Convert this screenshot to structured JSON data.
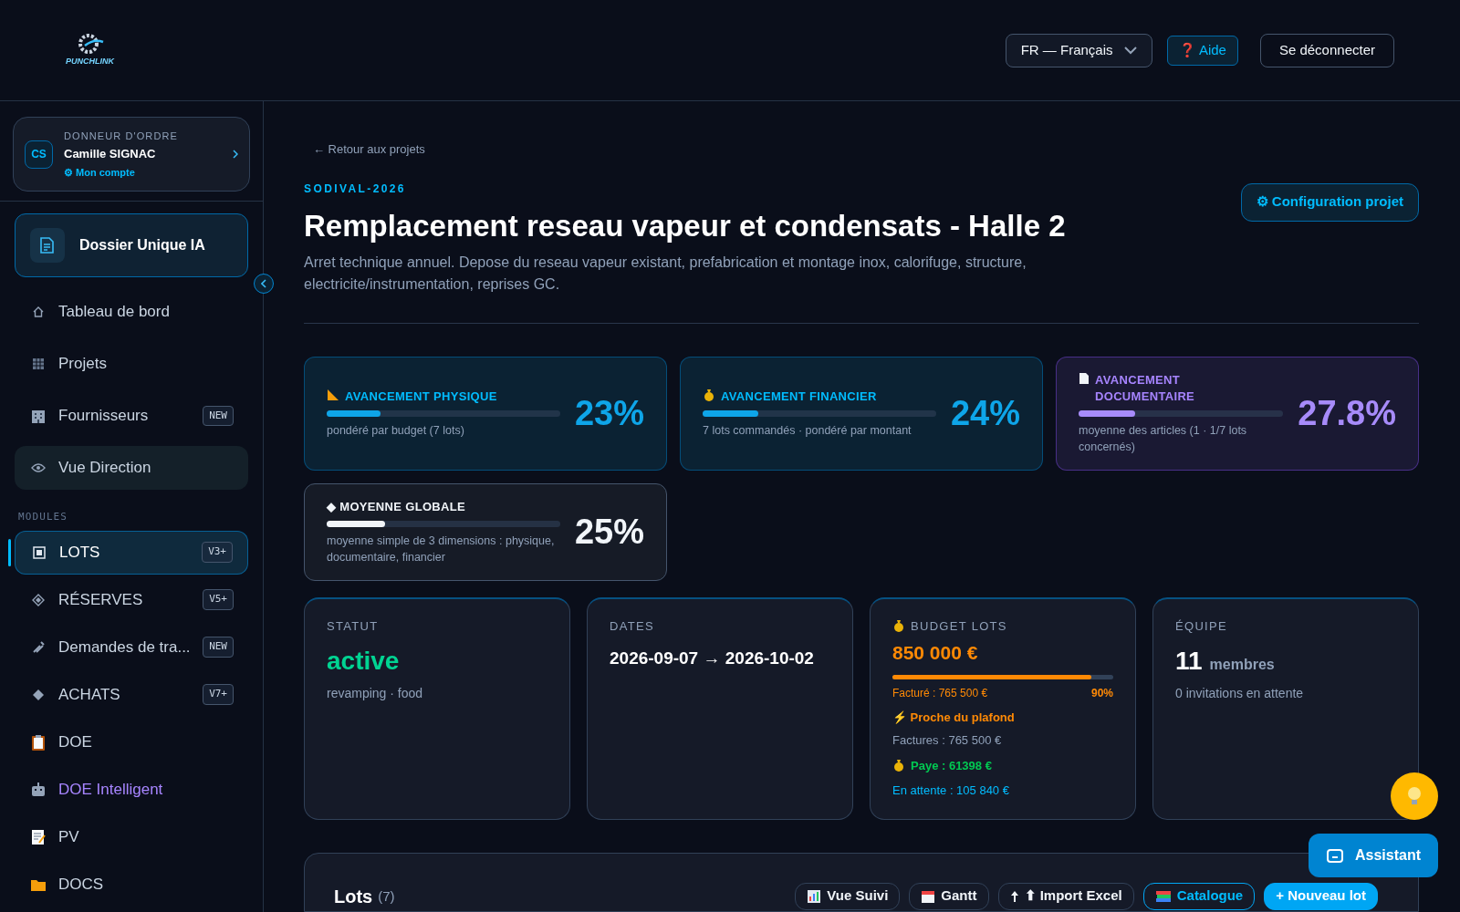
{
  "header": {
    "logo_text": "PUNCHLINK",
    "language": "FR — Français",
    "help": "❓ Aide",
    "logout": "Se déconnecter"
  },
  "sidebar": {
    "user": {
      "initials": "CS",
      "role": "DONNEUR D'ORDRE",
      "name": "Camille SIGNAC",
      "account": "⚙ Mon compte"
    },
    "featured": "Dossier Unique IA",
    "items": [
      {
        "label": "Tableau de bord",
        "kind": "nav",
        "selected": false
      },
      {
        "label": "Projets",
        "kind": "nav",
        "selected": false
      },
      {
        "label": "Fournisseurs",
        "kind": "nav",
        "badge": "NEW",
        "selected": false
      },
      {
        "label": "Vue Direction",
        "kind": "card",
        "selected": false
      }
    ],
    "section": "MODULES",
    "modules": [
      {
        "label": "LOTS",
        "kind": "nav",
        "badge": "V3+",
        "selected": true
      },
      {
        "label": "RÉSERVES",
        "kind": "nav",
        "badge": "V5+",
        "selected": false
      },
      {
        "label": "Demandes de tra...",
        "kind": "nav",
        "badge": "NEW",
        "selected": false
      },
      {
        "label": "ACHATS",
        "kind": "nav",
        "badge": "V7+",
        "selected": false
      },
      {
        "label": "DOE",
        "kind": "nav",
        "selected": false
      },
      {
        "label": "DOE Intelligent",
        "kind": "ai",
        "selected": false
      },
      {
        "label": "PV",
        "kind": "nav",
        "selected": false
      },
      {
        "label": "DOCS",
        "kind": "nav",
        "selected": false
      }
    ]
  },
  "project": {
    "back": "← Retour aux projets",
    "code": "SODIVAL-2026",
    "title": "Remplacement reseau vapeur et condensats - Halle 2",
    "description": "Arret technique annuel. Depose du reseau vapeur existant, prefabrication et montage inox, calorifuge, structure, electricite/instrumentation, reprises GC.",
    "config": "⚙ Configuration projet"
  },
  "progress": [
    {
      "title": "AVANCEMENT PHYSIQUE",
      "level": 0.23,
      "value": "23%",
      "note": "pondéré par budget (7 lots)",
      "color": "#0ea5e9"
    },
    {
      "title": "AVANCEMENT FINANCIER",
      "level": 0.24,
      "value": "24%",
      "note": "7 lots commandés · pondéré par montant",
      "color": "#0ea5e9"
    },
    {
      "title": "AVANCEMENT DOCUMENTAIRE",
      "level": 0.278,
      "value": "27.8%",
      "note": "moyenne des articles (1 · 1/7 lots concernés)",
      "color": "#a78bfa"
    },
    {
      "title": "◆ MOYENNE GLOBALE",
      "level": 0.25,
      "value": "25%",
      "note": "moyenne simple de 3 dimensions : physique, documentaire, financier",
      "color": "#f1f5f9"
    }
  ],
  "stats": {
    "status": {
      "label": "STATUT",
      "value": "active",
      "sub": "revamping · food"
    },
    "dates": {
      "label": "DATES",
      "value": "2026-09-07 → 2026-10-02"
    },
    "budget": {
      "label": "BUDGET LOTS",
      "value": "850 000 €",
      "level": 0.9,
      "invoiced": "Facturé : 765 500 €",
      "percent": "90%",
      "warning": "⚡ Proche du plafond",
      "invoices": "Factures : 765 500 €",
      "paid": "Paye : 61398 €",
      "pending": "En attente : 105 840 €"
    },
    "team": {
      "label": "ÉQUIPE",
      "count": "11",
      "unit": "membres",
      "sub": "0 invitations en attente"
    }
  },
  "lots": {
    "title": "Lots",
    "count": "(7)",
    "actions": [
      {
        "label": "Vue Suivi",
        "kind": "plain"
      },
      {
        "label": "Gantt",
        "kind": "plain"
      },
      {
        "label": "⬆ Import Excel",
        "kind": "plain"
      },
      {
        "label": "Catalogue",
        "kind": "outline"
      },
      {
        "label": "+ Nouveau lot",
        "kind": "primary"
      }
    ]
  },
  "assistant": "Assistant"
}
